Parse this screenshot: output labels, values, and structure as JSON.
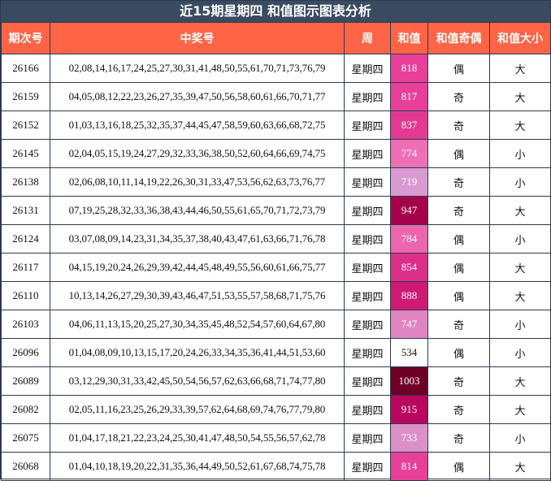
{
  "title": "近15期星期四 和值图示图表分析",
  "headers": [
    "期次号",
    "中奖号",
    "周",
    "和值",
    "和值奇偶",
    "和值大小"
  ],
  "rows": [
    {
      "issue": "26166",
      "numbers": "02,08,14,16,17,24,25,27,30,31,41,48,50,55,61,70,71,73,76,79",
      "weekday": "星期四",
      "sum": "818",
      "odd_even": "偶",
      "size": "大",
      "color": "#e8409a"
    },
    {
      "issue": "26159",
      "numbers": "04,05,08,12,22,23,26,27,35,39,47,50,56,58,60,61,66,70,71,77",
      "weekday": "星期四",
      "sum": "817",
      "odd_even": "奇",
      "size": "大",
      "color": "#e8409a"
    },
    {
      "issue": "26152",
      "numbers": "01,03,13,16,18,25,32,35,37,44,45,47,58,59,60,63,66,68,72,75",
      "weekday": "星期四",
      "sum": "837",
      "odd_even": "奇",
      "size": "大",
      "color": "#e23a92"
    },
    {
      "issue": "26145",
      "numbers": "02,04,05,15,19,24,27,29,32,33,36,38,50,52,60,64,66,69,74,75",
      "weekday": "星期四",
      "sum": "774",
      "odd_even": "偶",
      "size": "小",
      "color": "#ee6fb3"
    },
    {
      "issue": "26138",
      "numbers": "02,06,08,10,11,14,19,22,26,30,31,33,47,53,56,62,63,73,76,77",
      "weekday": "星期四",
      "sum": "719",
      "odd_even": "奇",
      "size": "小",
      "color": "#d89ad0"
    },
    {
      "issue": "26131",
      "numbers": "07,19,25,28,32,33,36,38,43,44,46,50,55,61,65,70,71,72,73,79",
      "weekday": "星期四",
      "sum": "947",
      "odd_even": "奇",
      "size": "大",
      "color": "#a5004a"
    },
    {
      "issue": "26124",
      "numbers": "03,07,08,09,14,23,31,34,35,37,38,40,43,47,61,63,66,71,76,78",
      "weekday": "星期四",
      "sum": "784",
      "odd_even": "偶",
      "size": "小",
      "color": "#ec66ad"
    },
    {
      "issue": "26117",
      "numbers": "04,15,19,20,24,26,29,39,42,44,45,48,49,55,56,60,61,66,75,77",
      "weekday": "星期四",
      "sum": "854",
      "odd_even": "偶",
      "size": "大",
      "color": "#dd2e8a"
    },
    {
      "issue": "26110",
      "numbers": "10,13,14,26,27,29,30,39,43,46,47,51,53,55,57,58,68,71,75,76",
      "weekday": "星期四",
      "sum": "888",
      "odd_even": "偶",
      "size": "大",
      "color": "#cf1a74"
    },
    {
      "issue": "26103",
      "numbers": "04,06,11,13,15,20,25,27,30,34,35,45,48,52,54,57,60,64,67,80",
      "weekday": "星期四",
      "sum": "747",
      "odd_even": "奇",
      "size": "小",
      "color": "#e084c2"
    },
    {
      "issue": "26096",
      "numbers": "01,04,08,09,10,13,15,17,20,24,26,33,34,35,36,41,44,51,53,60",
      "weekday": "星期四",
      "sum": "534",
      "odd_even": "偶",
      "size": "小",
      "color": "#ffffff"
    },
    {
      "issue": "26089",
      "numbers": "03,12,29,30,31,33,42,45,50,54,56,57,62,63,66,68,71,74,77,80",
      "weekday": "星期四",
      "sum": "1003",
      "odd_even": "奇",
      "size": "大",
      "color": "#6e0026"
    },
    {
      "issue": "26082",
      "numbers": "02,05,11,16,23,25,26,29,33,39,57,62,64,68,69,74,76,77,79,80",
      "weekday": "星期四",
      "sum": "915",
      "odd_even": "奇",
      "size": "大",
      "color": "#b8075c"
    },
    {
      "issue": "26075",
      "numbers": "01,04,17,18,21,22,23,24,25,30,41,47,48,50,54,55,56,57,62,78",
      "weekday": "星期四",
      "sum": "733",
      "odd_even": "奇",
      "size": "小",
      "color": "#dc90c8"
    },
    {
      "issue": "26068",
      "numbers": "01,04,10,18,19,20,22,31,35,36,44,49,50,52,61,67,68,74,75,78",
      "weekday": "星期四",
      "sum": "814",
      "odd_even": "偶",
      "size": "大",
      "color": "#e8409a"
    }
  ]
}
